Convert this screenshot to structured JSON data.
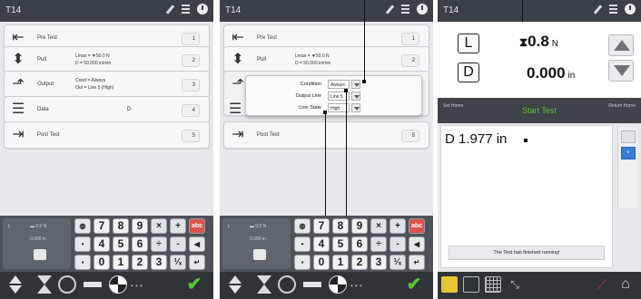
{
  "panel1": {
    "status_title": "T14",
    "rows": [
      {
        "icon": "pre-test-icon",
        "name": "Pre Test",
        "line1": "",
        "line2": "",
        "mid": "",
        "num": "1"
      },
      {
        "icon": "pull-icon",
        "name": "Pull",
        "line1": "Lmax = ▼50.0 N",
        "line2": "D = 50.000 in/min",
        "mid": "",
        "num": "2"
      },
      {
        "icon": "output-icon",
        "name": "Output",
        "line1": "Cond = Always",
        "line2": "Out = Line 5 (High)",
        "mid": "",
        "num": "3"
      },
      {
        "icon": "data-icon",
        "name": "Data",
        "line1": "",
        "line2": "",
        "mid": "D",
        "num": "4"
      },
      {
        "icon": "post-test-icon",
        "name": "Post Test",
        "line1": "",
        "line2": "",
        "mid": "",
        "num": "5"
      }
    ],
    "keypad_status": {
      "l1": "L",
      "l2": "▬ 0.0 N",
      "l3": "0.000 in"
    }
  },
  "keypad": {
    "row1": [
      "◍",
      "7",
      "8",
      "9",
      "×",
      "+",
      "abc"
    ],
    "row2": [
      "•",
      "4",
      "5",
      "6",
      "÷",
      "-",
      "◀"
    ],
    "row3": [
      "▪",
      "0",
      "1",
      "2",
      "3",
      "¹⁄ₓ",
      "↵"
    ]
  },
  "panel2": {
    "status_title": "T14",
    "rows": [
      {
        "name": "Pre Test",
        "line1": "",
        "line2": "",
        "num": "1"
      },
      {
        "name": "Pull",
        "line1": "Lmax = ▼50.0 N",
        "line2": "D = 50.000 in/min",
        "num": "2"
      },
      {
        "name": "Post Test",
        "line1": "",
        "line2": "",
        "num": "5"
      }
    ],
    "popup": {
      "condition_label": "Condition",
      "condition_value": "Always",
      "output_line_label": "Output Line",
      "output_line_value": "Line 5",
      "line_state_label": "Line State",
      "line_state_value": "High"
    }
  },
  "panel3": {
    "status_title": "T14",
    "load_label": "L",
    "load_value": "0.8",
    "load_unit": "N",
    "dist_label": "D",
    "dist_value": "0.000",
    "dist_unit": "in",
    "control_left": "Set Home",
    "control_mid": "Start Test",
    "control_right": "Return Home",
    "log_text": "D 1.977 in",
    "message": "The Test has finished running!"
  },
  "colors": {
    "accent_green": "#5bc236",
    "status_bar": "#3b4148",
    "bottom_bar": "#2f3439"
  }
}
